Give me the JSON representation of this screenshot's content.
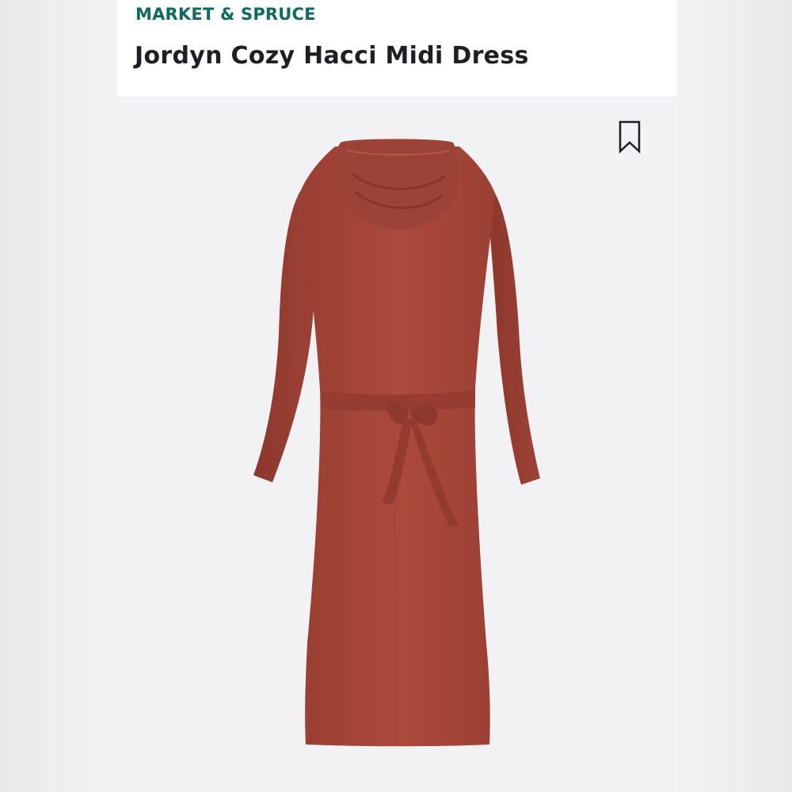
{
  "product": {
    "brand": "MARKET & SPRUCE",
    "title": "Jordyn Cozy Hacci Midi Dress"
  },
  "image": {
    "subject": "dress",
    "color": "#a8483a"
  },
  "icons": {
    "bookmark": "bookmark-icon"
  },
  "colors": {
    "brand": "#0f6b5c",
    "title": "#1e1f24",
    "header_bg": "#ffffff",
    "image_bg": "#f2f2f4"
  }
}
